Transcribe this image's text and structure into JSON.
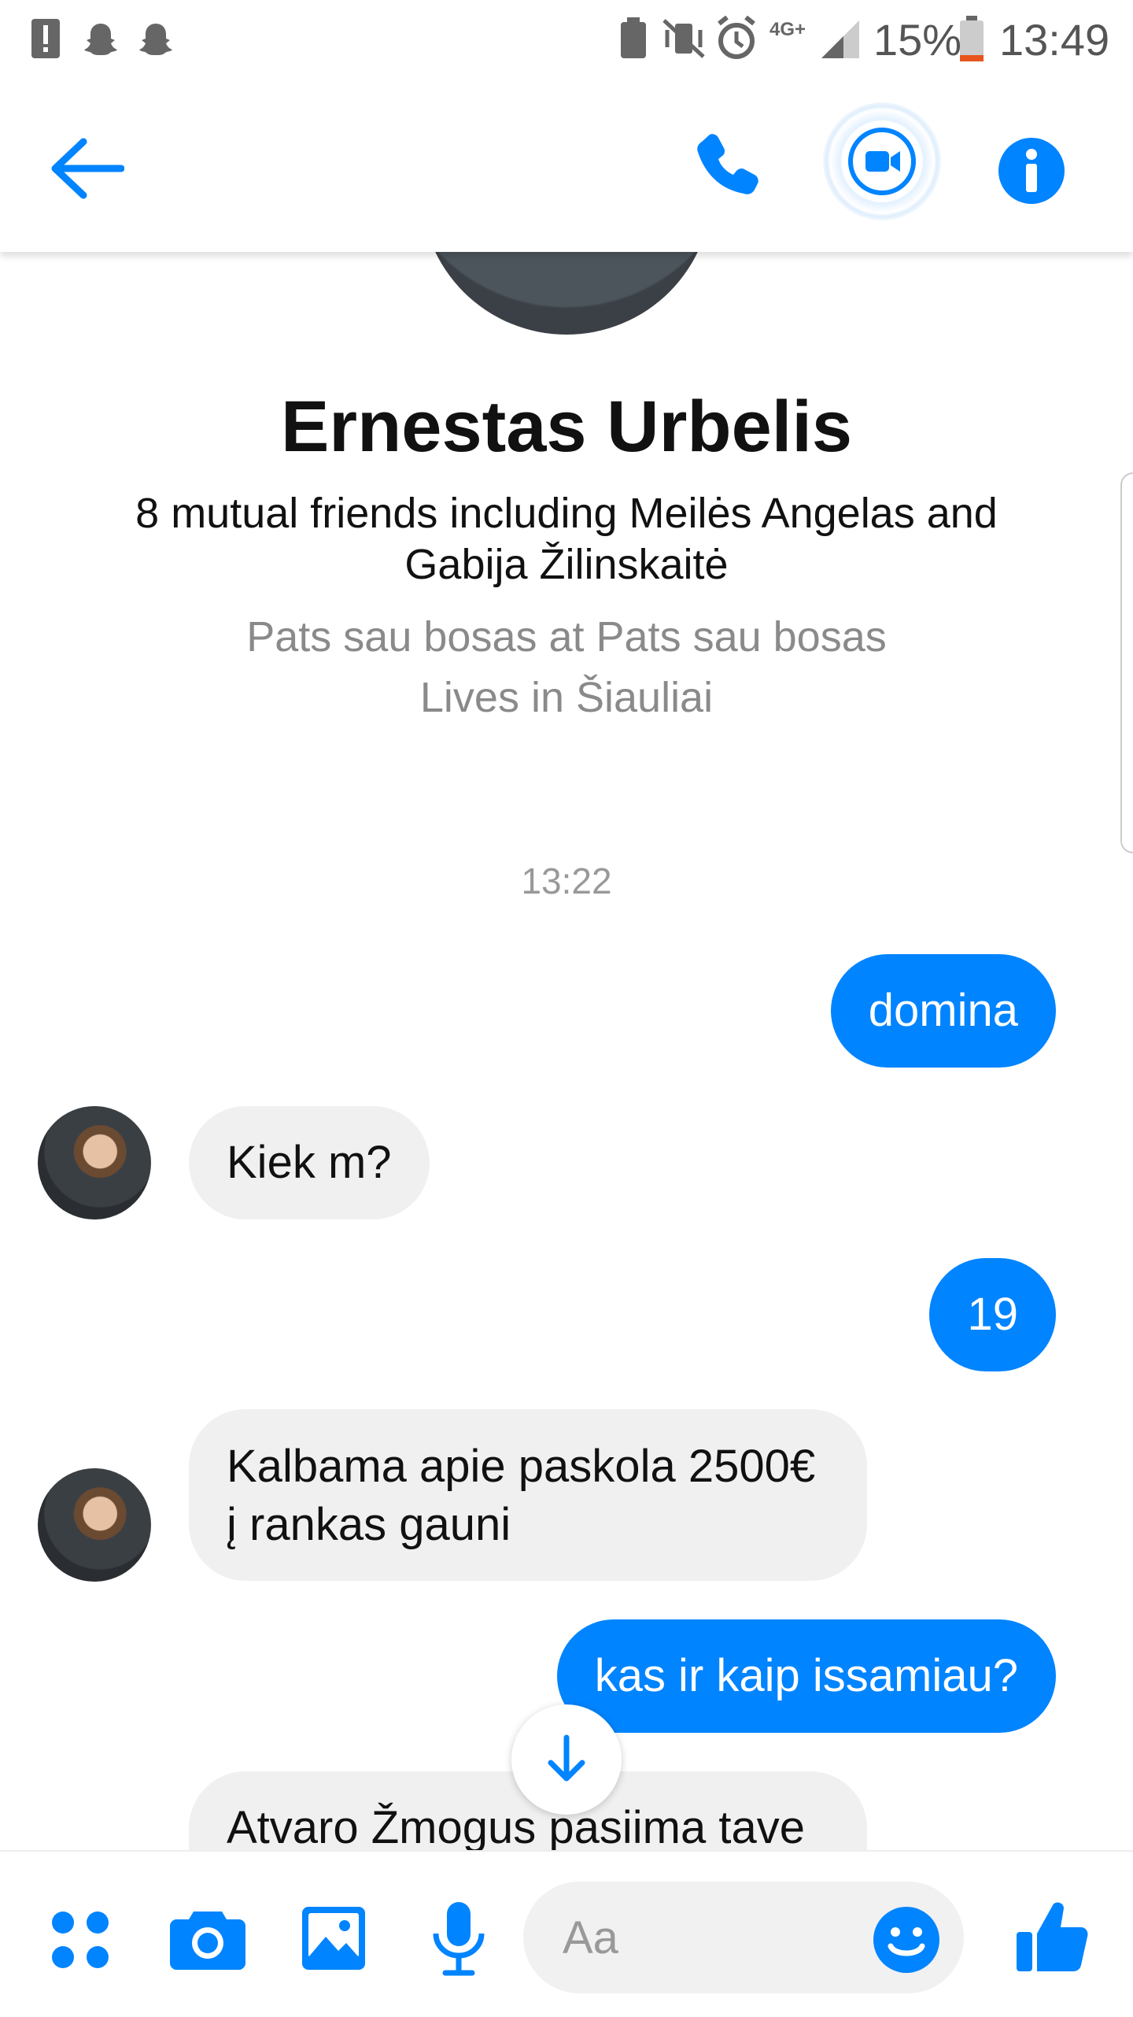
{
  "status_bar": {
    "battery": "15%",
    "time": "13:49",
    "network": "4G+"
  },
  "header": {
    "back_icon": "arrow-left-icon",
    "call_icon": "phone-icon",
    "video_icon": "video-camera-icon",
    "info_icon": "info-icon"
  },
  "profile": {
    "name": "Ernestas Urbelis",
    "mutual_friends": "8 mutual friends including Meilės Angelas and Gabija Žilinskaitė",
    "work": "Pats sau bosas at Pats sau bosas",
    "lives": "Lives in Šiauliai"
  },
  "conversation": {
    "timestamp": "13:22",
    "messages": [
      {
        "from": "me",
        "text": "domina"
      },
      {
        "from": "them",
        "text": "Kiek m?"
      },
      {
        "from": "me",
        "text": "19"
      },
      {
        "from": "them",
        "text": "Kalbama apie paskola 2500€ į rankas gauni"
      },
      {
        "from": "me",
        "text": "kas ir kaip issamiau?"
      },
      {
        "from": "them",
        "text": "Atvaro Žmogus pasiima tave"
      }
    ]
  },
  "composer": {
    "placeholder": "Aa"
  },
  "colors": {
    "accent": "#0084ff",
    "incoming_bubble": "#f1f0f0"
  }
}
